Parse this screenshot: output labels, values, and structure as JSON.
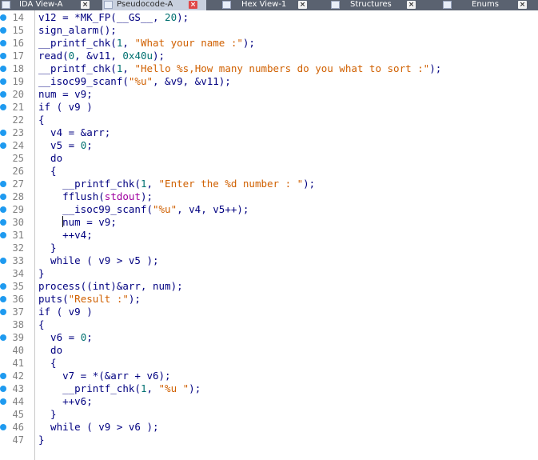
{
  "tabs": [
    {
      "label": "IDA View-A",
      "active": false,
      "icon": "ida-view-icon"
    },
    {
      "label": "Pseudocode-A",
      "active": true,
      "icon": "pseudocode-icon"
    },
    {
      "label": "Hex View-1",
      "active": false,
      "icon": "hex-view-icon"
    },
    {
      "label": "Structures",
      "active": false,
      "icon": "structures-icon"
    },
    {
      "label": "Enums",
      "active": false,
      "icon": "enums-icon"
    }
  ],
  "colors": {
    "breakpoint": "#1e9af0",
    "string": "#d06000",
    "number": "#007070",
    "identifier": "#000080",
    "global": "#a000a0"
  },
  "lines": [
    {
      "num": "14",
      "bp": true,
      "tokens": [
        [
          "v12 = *MK_FP(__GS__, ",
          "k"
        ],
        [
          "20",
          "n"
        ],
        [
          ");",
          "k"
        ]
      ]
    },
    {
      "num": "15",
      "bp": true,
      "tokens": [
        [
          "sign_alarm();",
          "k"
        ]
      ]
    },
    {
      "num": "16",
      "bp": true,
      "tokens": [
        [
          "__printf_chk(",
          "k"
        ],
        [
          "1",
          "n"
        ],
        [
          ", ",
          "k"
        ],
        [
          "\"What your name :\"",
          "s"
        ],
        [
          ");",
          "k"
        ]
      ]
    },
    {
      "num": "17",
      "bp": true,
      "tokens": [
        [
          "read(",
          "k"
        ],
        [
          "0",
          "n"
        ],
        [
          ", &v11, ",
          "k"
        ],
        [
          "0x40u",
          "n"
        ],
        [
          ");",
          "k"
        ]
      ]
    },
    {
      "num": "18",
      "bp": true,
      "tokens": [
        [
          "__printf_chk(",
          "k"
        ],
        [
          "1",
          "n"
        ],
        [
          ", ",
          "k"
        ],
        [
          "\"Hello %s,How many numbers do you what to sort :\"",
          "s"
        ],
        [
          ");",
          "k"
        ]
      ]
    },
    {
      "num": "19",
      "bp": true,
      "tokens": [
        [
          "__isoc99_scanf(",
          "k"
        ],
        [
          "\"%u\"",
          "s"
        ],
        [
          ", &v9, &v11);",
          "k"
        ]
      ]
    },
    {
      "num": "20",
      "bp": true,
      "tokens": [
        [
          "num = v9;",
          "k"
        ]
      ]
    },
    {
      "num": "21",
      "bp": true,
      "tokens": [
        [
          "if ( v9 )",
          "k"
        ]
      ]
    },
    {
      "num": "22",
      "bp": false,
      "tokens": [
        [
          "{",
          "k"
        ]
      ]
    },
    {
      "num": "23",
      "bp": true,
      "tokens": [
        [
          "  v4 = &arr;",
          "k"
        ]
      ]
    },
    {
      "num": "24",
      "bp": true,
      "tokens": [
        [
          "  v5 = ",
          "k"
        ],
        [
          "0",
          "n"
        ],
        [
          ";",
          "k"
        ]
      ]
    },
    {
      "num": "25",
      "bp": false,
      "tokens": [
        [
          "  do",
          "k"
        ]
      ]
    },
    {
      "num": "26",
      "bp": false,
      "tokens": [
        [
          "  {",
          "k"
        ]
      ]
    },
    {
      "num": "27",
      "bp": true,
      "tokens": [
        [
          "    __printf_chk(",
          "k"
        ],
        [
          "1",
          "n"
        ],
        [
          ", ",
          "k"
        ],
        [
          "\"Enter the %d number : \"",
          "s"
        ],
        [
          ");",
          "k"
        ]
      ]
    },
    {
      "num": "28",
      "bp": true,
      "tokens": [
        [
          "    fflush(",
          "k"
        ],
        [
          "stdout",
          "m"
        ],
        [
          ");",
          "k"
        ]
      ]
    },
    {
      "num": "29",
      "bp": true,
      "tokens": [
        [
          "    __isoc99_scanf(",
          "k"
        ],
        [
          "\"%u\"",
          "s"
        ],
        [
          ", v4, v5++);",
          "k"
        ]
      ]
    },
    {
      "num": "30",
      "bp": true,
      "caret": true,
      "tokens": [
        [
          "    ",
          "k"
        ],
        [
          "|",
          "caret"
        ],
        [
          "num = v9;",
          "k"
        ]
      ]
    },
    {
      "num": "31",
      "bp": true,
      "tokens": [
        [
          "    ++v4;",
          "k"
        ]
      ]
    },
    {
      "num": "32",
      "bp": false,
      "tokens": [
        [
          "  }",
          "k"
        ]
      ]
    },
    {
      "num": "33",
      "bp": true,
      "tokens": [
        [
          "  while ( v9 > v5 );",
          "k"
        ]
      ]
    },
    {
      "num": "34",
      "bp": false,
      "tokens": [
        [
          "}",
          "k"
        ]
      ]
    },
    {
      "num": "35",
      "bp": true,
      "tokens": [
        [
          "process((int)&arr, num);",
          "k"
        ]
      ]
    },
    {
      "num": "36",
      "bp": true,
      "tokens": [
        [
          "puts(",
          "k"
        ],
        [
          "\"Result :\"",
          "s"
        ],
        [
          ");",
          "k"
        ]
      ]
    },
    {
      "num": "37",
      "bp": true,
      "tokens": [
        [
          "if ( v9 )",
          "k"
        ]
      ]
    },
    {
      "num": "38",
      "bp": false,
      "tokens": [
        [
          "{",
          "k"
        ]
      ]
    },
    {
      "num": "39",
      "bp": true,
      "tokens": [
        [
          "  v6 = ",
          "k"
        ],
        [
          "0",
          "n"
        ],
        [
          ";",
          "k"
        ]
      ]
    },
    {
      "num": "40",
      "bp": false,
      "tokens": [
        [
          "  do",
          "k"
        ]
      ]
    },
    {
      "num": "41",
      "bp": false,
      "tokens": [
        [
          "  {",
          "k"
        ]
      ]
    },
    {
      "num": "42",
      "bp": true,
      "tokens": [
        [
          "    v7 = *(&arr + v6);",
          "k"
        ]
      ]
    },
    {
      "num": "43",
      "bp": true,
      "tokens": [
        [
          "    __printf_chk(",
          "k"
        ],
        [
          "1",
          "n"
        ],
        [
          ", ",
          "k"
        ],
        [
          "\"%u \"",
          "s"
        ],
        [
          ");",
          "k"
        ]
      ]
    },
    {
      "num": "44",
      "bp": true,
      "tokens": [
        [
          "    ++v6;",
          "k"
        ]
      ]
    },
    {
      "num": "45",
      "bp": false,
      "tokens": [
        [
          "  }",
          "k"
        ]
      ]
    },
    {
      "num": "46",
      "bp": true,
      "tokens": [
        [
          "  while ( v9 > v6 );",
          "k"
        ]
      ]
    },
    {
      "num": "47",
      "bp": false,
      "tokens": [
        [
          "}",
          "k"
        ]
      ]
    }
  ]
}
